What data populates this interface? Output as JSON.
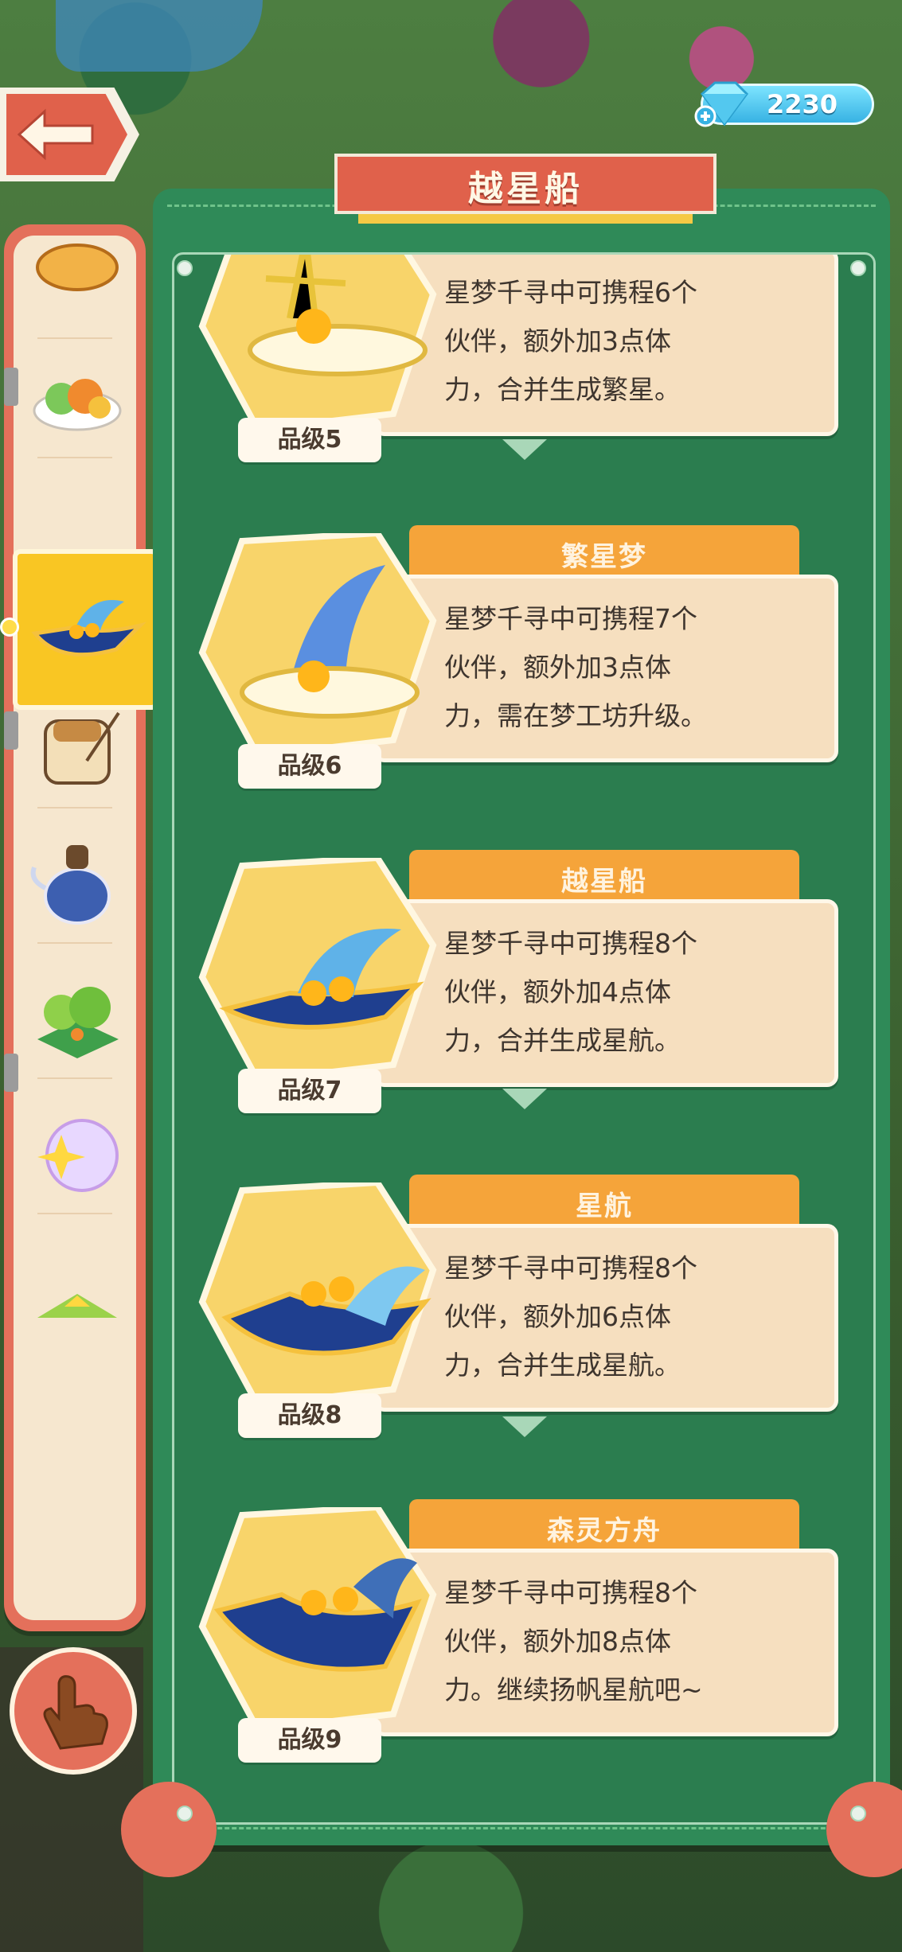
{
  "currency": {
    "amount": "2230",
    "icon": "gem-icon"
  },
  "panel": {
    "title": "越星船"
  },
  "sidebar": {
    "categories": [
      {
        "name": "bread",
        "active": false
      },
      {
        "name": "salad",
        "active": false
      },
      {
        "name": "starship",
        "active": true
      },
      {
        "name": "backpack",
        "active": false
      },
      {
        "name": "teapot",
        "active": false
      },
      {
        "name": "forest",
        "active": false
      },
      {
        "name": "bubble-star",
        "active": false
      },
      {
        "name": "mountain",
        "active": false
      }
    ]
  },
  "items": [
    {
      "name": "",
      "desc": [
        "星梦千寻中可携程6个",
        "伙伴，额外加3点体",
        "力，合并生成繁星。"
      ],
      "grade": "品级5"
    },
    {
      "name": "繁星梦",
      "desc": [
        "星梦千寻中可携程7个",
        "伙伴，额外加3点体",
        "力，需在梦工坊升级。"
      ],
      "grade": "品级6"
    },
    {
      "name": "越星船",
      "desc": [
        "星梦千寻中可携程8个",
        "伙伴，额外加4点体",
        "力，合并生成星航。"
      ],
      "grade": "品级7"
    },
    {
      "name": "星航",
      "desc": [
        "星梦千寻中可携程8个",
        "伙伴，额外加6点体",
        "力，合并生成星航。"
      ],
      "grade": "品级8"
    },
    {
      "name": "森灵方舟",
      "desc": [
        "星梦千寻中可携程8个",
        "伙伴，额外加8点体",
        "力。继续扬帆星航吧~"
      ],
      "grade": "品级9"
    }
  ]
}
